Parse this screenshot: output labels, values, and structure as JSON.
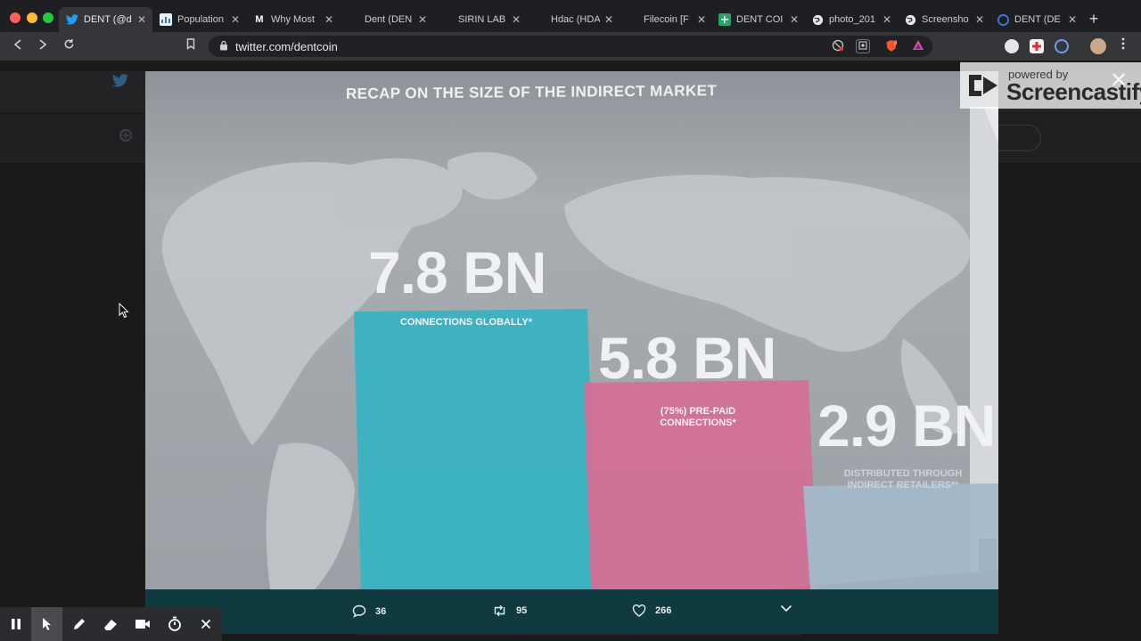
{
  "browser": {
    "tabs": [
      {
        "title": "DENT (@d",
        "favicon": "twitter-icon",
        "active": true
      },
      {
        "title": "Population",
        "favicon": "chart-favicon-icon"
      },
      {
        "title": "Why Most",
        "favicon": "medium-icon"
      },
      {
        "title": "Dent (DEN",
        "favicon": "blank-favicon-icon"
      },
      {
        "title": "SIRIN LAB",
        "favicon": "blank-favicon-icon"
      },
      {
        "title": "Hdac (HDA",
        "favicon": "blank-favicon-icon"
      },
      {
        "title": "Filecoin [F",
        "favicon": "blank-favicon-icon"
      },
      {
        "title": "DENT COI",
        "favicon": "sheets-icon"
      },
      {
        "title": "photo_201",
        "favicon": "globe-icon"
      },
      {
        "title": "Screensho",
        "favicon": "globe-icon"
      },
      {
        "title": "DENT (DE",
        "favicon": "coin-icon"
      }
    ],
    "new_tab_label": "+",
    "url": "twitter.com/dentcoin"
  },
  "slide": {
    "title": "RECAP ON THE SIZE OF THE INDIRECT MARKET",
    "bars": [
      {
        "value_label": "7.8 BN",
        "caption": "CONNECTIONS GLOBALLY*",
        "value_bn": 7.8,
        "color": "#35b3c2"
      },
      {
        "value_label": "5.8 BN",
        "caption_line1": "(75%) PRE-PAID",
        "caption_line2": "CONNECTIONS*",
        "value_bn": 5.8,
        "color": "#d46f95"
      },
      {
        "value_label": "2.9 BN",
        "caption_line1": "DISTRIBUTED THROUGH",
        "caption_line2": "INDIRECT RETAILERS**",
        "value_bn": 2.9,
        "color": "#a3bacb"
      }
    ]
  },
  "tweet_actions": {
    "replies": "36",
    "retweets": "95",
    "likes": "266"
  },
  "screencastify": {
    "powered_by": "powered by",
    "brand": "Screencastify",
    "close_glyph": "✕"
  },
  "colors": {
    "accent_teal": "#0f3a3f",
    "twitter_blue": "#1da1f2"
  }
}
